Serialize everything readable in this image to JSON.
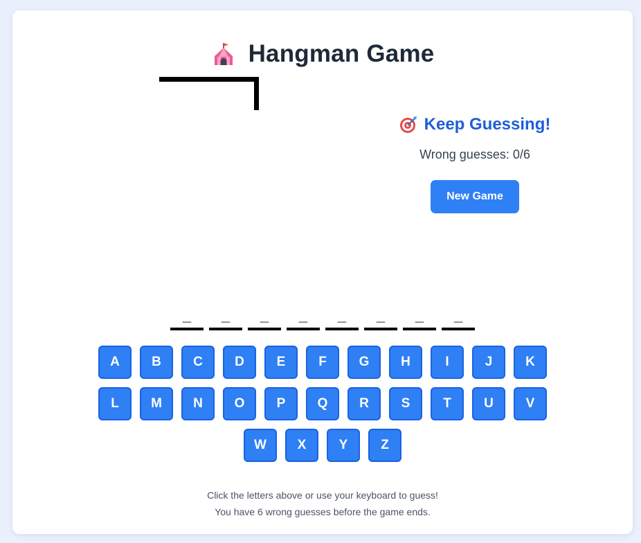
{
  "header": {
    "icon": "circus-tent-icon",
    "title": "Hangman Game"
  },
  "status": {
    "icon": "target-icon",
    "message": "Keep Guessing!",
    "wrong_guesses_text": "Wrong guesses: 0/6",
    "wrong_count": 0,
    "max_wrong": 6
  },
  "controls": {
    "new_game_label": "New Game"
  },
  "word": {
    "slots": [
      "_",
      "_",
      "_",
      "_",
      "_",
      "_",
      "_",
      "_"
    ]
  },
  "keyboard": {
    "rows": [
      [
        "A",
        "B",
        "C",
        "D",
        "E",
        "F",
        "G",
        "H",
        "I",
        "J",
        "K"
      ],
      [
        "L",
        "M",
        "N",
        "O",
        "P",
        "Q",
        "R",
        "S",
        "T",
        "U",
        "V"
      ],
      [
        "W",
        "X",
        "Y",
        "Z"
      ]
    ]
  },
  "instructions": {
    "line1": "Click the letters above or use your keyboard to guess!",
    "line2": "You have 6 wrong guesses before the game ends."
  },
  "colors": {
    "accent": "#2f7ff5",
    "status_text": "#1e5ed8",
    "background": "#eaf0fc"
  }
}
